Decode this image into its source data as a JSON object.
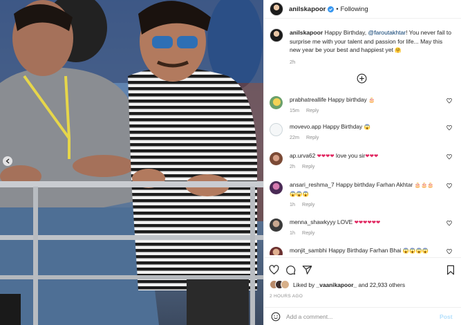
{
  "post": {
    "owner_handle": "anilskapoor",
    "follow_state": "Following",
    "separator": "•",
    "caption": {
      "handle": "anilskapoor",
      "text_before": "Happy Birthday, ",
      "mention": "@faroutakhtar",
      "text_after": "! You never fail to surprise me with your talent and passion for life... May this new year be your best and happiest yet",
      "emoji": "🤗",
      "time": "2h"
    }
  },
  "comments": [
    {
      "handle": "prabhatreallife",
      "text": "Happy birthday",
      "emoji": "🎂",
      "time": "15m",
      "reply": "Reply"
    },
    {
      "handle": "movevo.app",
      "text": "Happy Birthday",
      "emoji": "😱",
      "time": "22m",
      "reply": "Reply"
    },
    {
      "handle": "ap.urva62",
      "text": "love you sir",
      "emoji_before": "❤❤❤❤",
      "emoji": "❤❤❤",
      "time": "2h",
      "reply": "Reply"
    },
    {
      "handle": "ansari_reshma_7",
      "text": "Happy birthday Farhan Akhtar",
      "emoji": "🎂🎂🎂😱😱😱",
      "time": "1h",
      "reply": "Reply"
    },
    {
      "handle": "menna_shawkyyy",
      "text": "LOVE",
      "emoji": "❤❤❤❤❤❤",
      "time": "1h",
      "reply": "Reply"
    },
    {
      "handle": "monjit_sambhi",
      "text": "Happy Birthday Farhan Bhai",
      "emoji": "😱😱😱😱",
      "time": "",
      "reply": ""
    }
  ],
  "likes": {
    "text_prefix": "Liked by ",
    "liker": "_vaanikapoor_",
    "text_suffix": " and 22,933 others"
  },
  "timestamp": "2 HOURS AGO",
  "add_comment": {
    "placeholder": "Add a comment...",
    "post_label": "Post"
  },
  "icons": {
    "like": "heart-icon",
    "comment": "comment-icon",
    "share": "share-icon",
    "save": "bookmark-icon",
    "emoji": "smiley-icon",
    "more": "plus-circle-icon",
    "prev": "chevron-left-icon"
  },
  "colors": {
    "mention": "#00376b",
    "muted": "#8e8e8e",
    "verified": "#3897f0",
    "post_button": "#b2dffc"
  }
}
